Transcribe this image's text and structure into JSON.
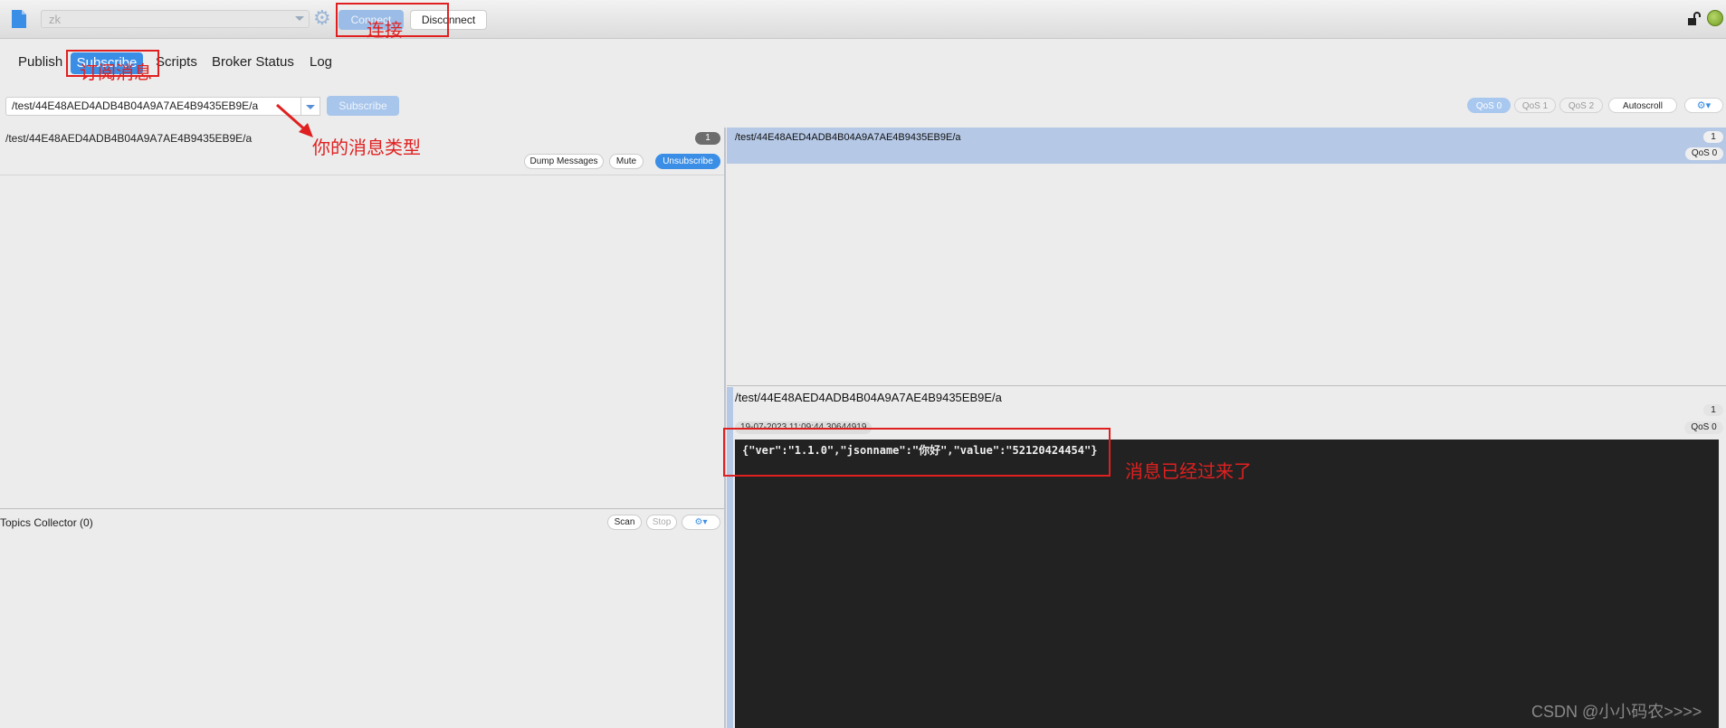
{
  "toolbar": {
    "profile_value": "zk",
    "connect_label": "Connect",
    "disconnect_label": "Disconnect",
    "gear_glyph": "⚙",
    "status_color": "#7fae2a"
  },
  "tabs": [
    {
      "label": "Publish"
    },
    {
      "label": "Subscribe"
    },
    {
      "label": "Scripts"
    },
    {
      "label": "Broker Status"
    },
    {
      "label": "Log"
    }
  ],
  "subscribe_bar": {
    "topic_value": "/test/44E48AED4ADB4B04A9A7AE4B9435EB9E/a",
    "subscribe_label": "Subscribe",
    "qos": [
      "QoS 0",
      "QoS 1",
      "QoS 2"
    ],
    "autoscroll_label": "Autoscroll",
    "options_label": "⚙▾"
  },
  "subscription": {
    "topic": "/test/44E48AED4ADB4B04A9A7AE4B9435EB9E/a",
    "count": "1",
    "dump_label": "Dump Messages",
    "mute_label": "Mute",
    "unsubscribe_label": "Unsubscribe"
  },
  "topics_collector": {
    "label": "Topics Collector (0)",
    "scan_label": "Scan",
    "stop_label": "Stop",
    "options_label": "⚙▾"
  },
  "message_list": {
    "topic": "/test/44E48AED4ADB4B04A9A7AE4B9435EB9E/a",
    "count": "1",
    "qos": "QoS 0"
  },
  "message_detail": {
    "topic": "/test/44E48AED4ADB4B04A9A7AE4B9435EB9E/a",
    "count": "1",
    "timestamp": "19-07-2023 11:09:44.30644919",
    "qos": "QoS 0",
    "payload": "{\"ver\":\"1.1.0\",\"jsonname\":\"你好\",\"value\":\"52120424454\"}"
  },
  "annotations": {
    "connect": "连接",
    "subscribe": "订阅消息",
    "message_type": "你的消息类型",
    "arrived": "消息已经过来了",
    "watermark": "CSDN @小小码农>>>>"
  }
}
